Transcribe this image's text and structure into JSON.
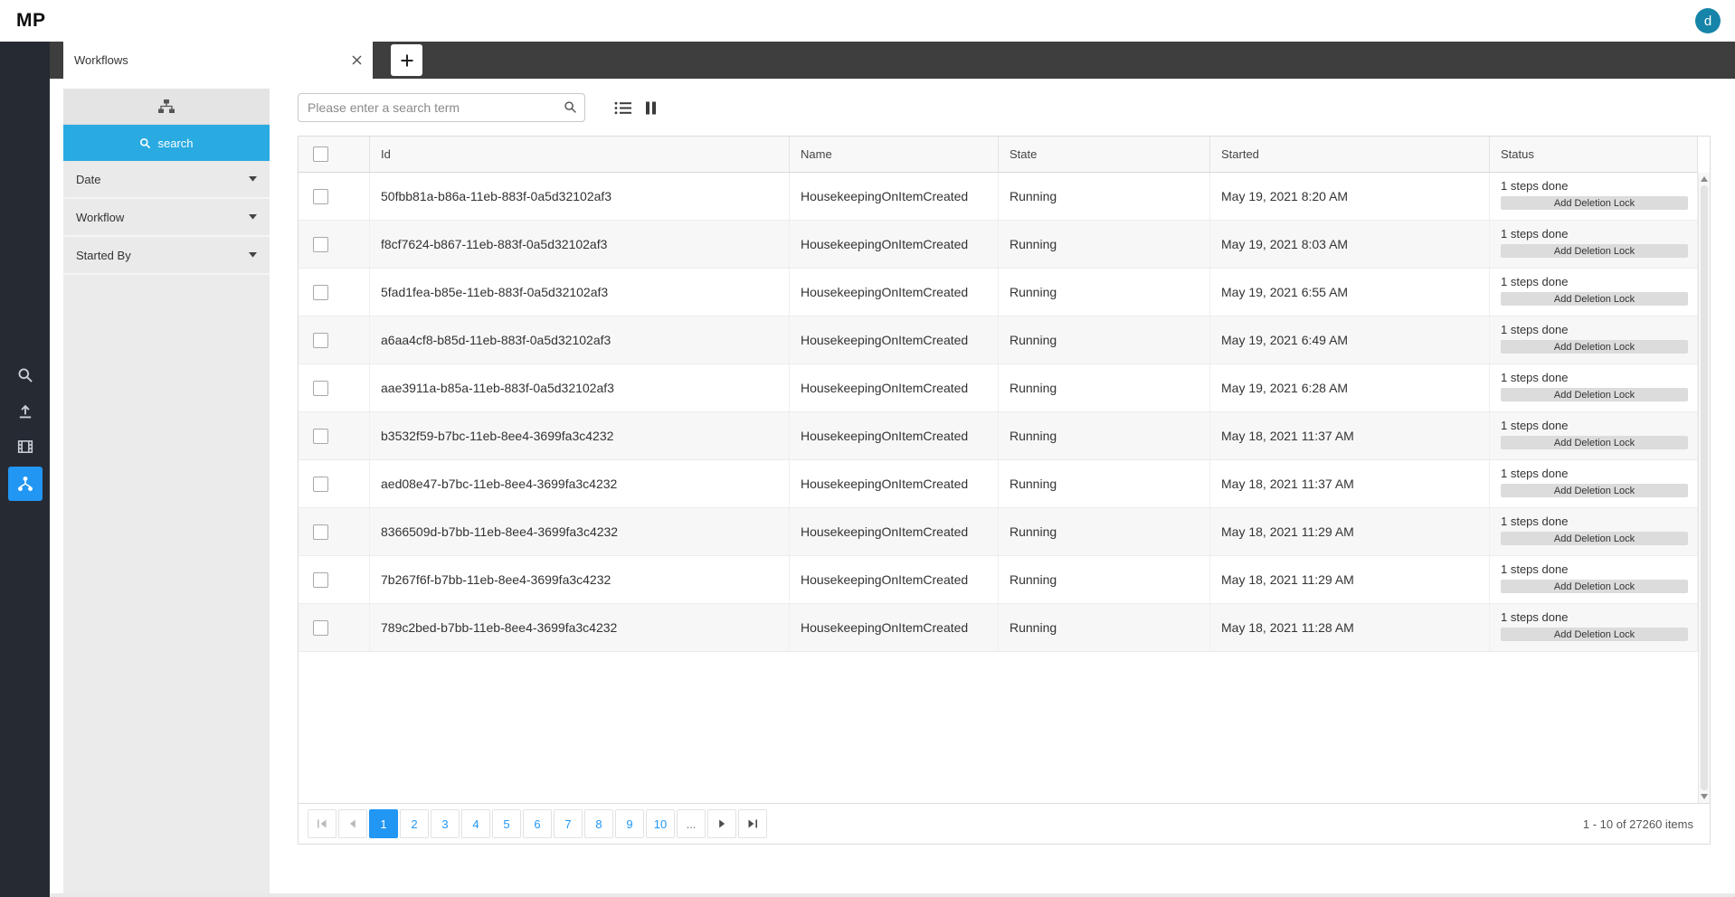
{
  "colors": {
    "accent": "#2196f3",
    "filter_search_button": "#29abe2",
    "avatar_bg": "#1684a8",
    "rail_bg": "#262a33",
    "tabbar_bg": "#3e3e3e"
  },
  "app": {
    "logo": "MP",
    "user_initial": "d"
  },
  "tab_bar": {
    "active_tab": "Workflows"
  },
  "rail": {
    "items": [
      "search-icon",
      "upload-icon",
      "media-icon",
      "workflow-icon"
    ],
    "active": "workflow-icon"
  },
  "filter_panel": {
    "search_button": "search",
    "sections": [
      {
        "label": "Date"
      },
      {
        "label": "Workflow"
      },
      {
        "label": "Started By"
      }
    ]
  },
  "toolbar": {
    "search_placeholder": "Please enter a search term"
  },
  "grid": {
    "columns": [
      "Id",
      "Name",
      "State",
      "Started",
      "Status"
    ],
    "rows": [
      {
        "id": "50fbb81a-b86a-11eb-883f-0a5d32102af3",
        "name": "HousekeepingOnItemCreated",
        "state": "Running",
        "started": "May 19, 2021 8:20 AM",
        "steps": "1 steps done",
        "action": "Add Deletion Lock"
      },
      {
        "id": "f8cf7624-b867-11eb-883f-0a5d32102af3",
        "name": "HousekeepingOnItemCreated",
        "state": "Running",
        "started": "May 19, 2021 8:03 AM",
        "steps": "1 steps done",
        "action": "Add Deletion Lock"
      },
      {
        "id": "5fad1fea-b85e-11eb-883f-0a5d32102af3",
        "name": "HousekeepingOnItemCreated",
        "state": "Running",
        "started": "May 19, 2021 6:55 AM",
        "steps": "1 steps done",
        "action": "Add Deletion Lock"
      },
      {
        "id": "a6aa4cf8-b85d-11eb-883f-0a5d32102af3",
        "name": "HousekeepingOnItemCreated",
        "state": "Running",
        "started": "May 19, 2021 6:49 AM",
        "steps": "1 steps done",
        "action": "Add Deletion Lock"
      },
      {
        "id": "aae3911a-b85a-11eb-883f-0a5d32102af3",
        "name": "HousekeepingOnItemCreated",
        "state": "Running",
        "started": "May 19, 2021 6:28 AM",
        "steps": "1 steps done",
        "action": "Add Deletion Lock"
      },
      {
        "id": "b3532f59-b7bc-11eb-8ee4-3699fa3c4232",
        "name": "HousekeepingOnItemCreated",
        "state": "Running",
        "started": "May 18, 2021 11:37 AM",
        "steps": "1 steps done",
        "action": "Add Deletion Lock"
      },
      {
        "id": "aed08e47-b7bc-11eb-8ee4-3699fa3c4232",
        "name": "HousekeepingOnItemCreated",
        "state": "Running",
        "started": "May 18, 2021 11:37 AM",
        "steps": "1 steps done",
        "action": "Add Deletion Lock"
      },
      {
        "id": "8366509d-b7bb-11eb-8ee4-3699fa3c4232",
        "name": "HousekeepingOnItemCreated",
        "state": "Running",
        "started": "May 18, 2021 11:29 AM",
        "steps": "1 steps done",
        "action": "Add Deletion Lock"
      },
      {
        "id": "7b267f6f-b7bb-11eb-8ee4-3699fa3c4232",
        "name": "HousekeepingOnItemCreated",
        "state": "Running",
        "started": "May 18, 2021 11:29 AM",
        "steps": "1 steps done",
        "action": "Add Deletion Lock"
      },
      {
        "id": "789c2bed-b7bb-11eb-8ee4-3699fa3c4232",
        "name": "HousekeepingOnItemCreated",
        "state": "Running",
        "started": "May 18, 2021 11:28 AM",
        "steps": "1 steps done",
        "action": "Add Deletion Lock"
      }
    ]
  },
  "pager": {
    "pages": [
      "1",
      "2",
      "3",
      "4",
      "5",
      "6",
      "7",
      "8",
      "9",
      "10"
    ],
    "active_page": "1",
    "ellipsis": "...",
    "info": "1 - 10 of 27260 items"
  }
}
